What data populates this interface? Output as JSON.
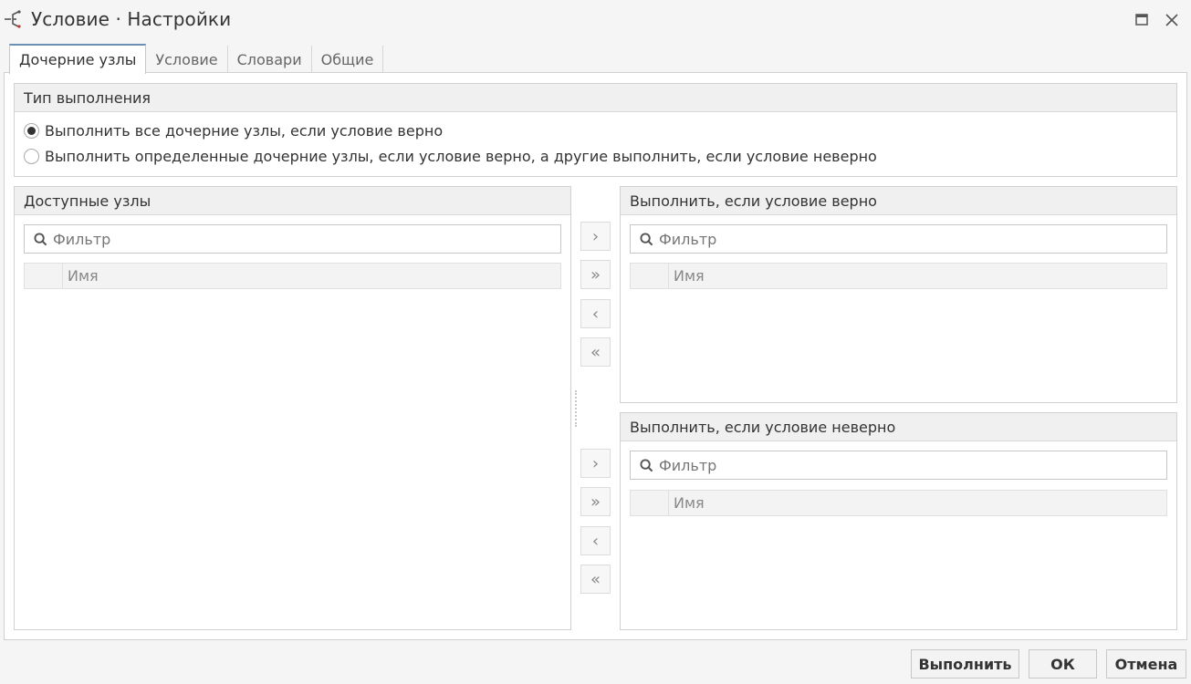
{
  "window": {
    "title": "Условие · Настройки"
  },
  "tabs": [
    {
      "label": "Дочерние узлы",
      "active": true
    },
    {
      "label": "Условие",
      "active": false
    },
    {
      "label": "Словари",
      "active": false
    },
    {
      "label": "Общие",
      "active": false
    }
  ],
  "execution_type": {
    "header": "Тип выполнения",
    "options": [
      {
        "label": "Выполнить все дочерние узлы, если условие верно",
        "selected": true
      },
      {
        "label": "Выполнить определенные дочерние узлы, если условие верно, а другие выполнить, если условие неверно",
        "selected": false
      }
    ]
  },
  "available_nodes": {
    "header": "Доступные узлы",
    "filter_placeholder": "Фильтр",
    "column_name": "Имя"
  },
  "true_nodes": {
    "header": "Выполнить, если условие верно",
    "filter_placeholder": "Фильтр",
    "column_name": "Имя"
  },
  "false_nodes": {
    "header": "Выполнить, если условие неверно",
    "filter_placeholder": "Фильтр",
    "column_name": "Имя"
  },
  "transfer_buttons": {
    "add": "›",
    "add_all": "»",
    "remove": "‹",
    "remove_all": "«"
  },
  "footer": {
    "execute": "Выполнить",
    "ok": "ОК",
    "cancel": "Отмена"
  },
  "colors": {
    "accent": "#6b8fb5",
    "header_bg": "#f0f0f0",
    "border": "#d0d0d0"
  }
}
